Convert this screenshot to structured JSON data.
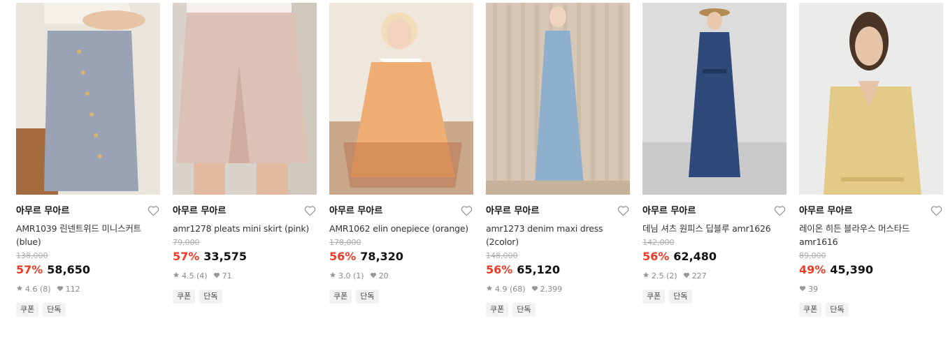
{
  "products": [
    {
      "brand": "아무르 무아르",
      "name": "AMR1039 린넨트위드 미니스커트 (blue)",
      "original_price": "138,000",
      "discount": "57%",
      "price": "58,650",
      "rating": "4.6",
      "review_count": "(8)",
      "likes": "112",
      "tags": [
        "쿠폰",
        "단독"
      ],
      "palette": {
        "bg": "#e9e4dc",
        "accent": "#9aa3b5",
        "skin": "#e8c4a6"
      }
    },
    {
      "brand": "아무르 무아르",
      "name": "amr1278 pleats mini skirt (pink)",
      "original_price": "79,000",
      "discount": "57%",
      "price": "33,575",
      "rating": "4.5",
      "review_count": "(4)",
      "likes": "71",
      "tags": [
        "쿠폰",
        "단독"
      ],
      "palette": {
        "bg": "#d9d3cb",
        "accent": "#dcc1b6",
        "skin": "#e3b99f"
      }
    },
    {
      "brand": "아무르 무아르",
      "name": "AMR1062 elin onepiece (orange)",
      "original_price": "178,000",
      "discount": "56%",
      "price": "78,320",
      "rating": "3.0",
      "review_count": "(1)",
      "likes": "20",
      "tags": [
        "쿠폰",
        "단독"
      ],
      "palette": {
        "bg": "#efe6dc",
        "accent": "#f0ad73",
        "skin": "#f1d3bd"
      }
    },
    {
      "brand": "아무르 무아르",
      "name": "amr1273 denim maxi dress (2color)",
      "original_price": "148,000",
      "discount": "56%",
      "price": "65,120",
      "rating": "4.9",
      "review_count": "(68)",
      "likes": "2,399",
      "tags": [
        "쿠폰",
        "단독"
      ],
      "palette": {
        "bg": "#d8c7b6",
        "accent": "#8eb0cc",
        "skin": "#efd3bf"
      }
    },
    {
      "brand": "아무르 무아르",
      "name": "데님 셔츠 원피스 딥블루 amr1626",
      "original_price": "142,000",
      "discount": "56%",
      "price": "62,480",
      "rating": "2.5",
      "review_count": "(2)",
      "likes": "227",
      "tags": [
        "쿠폰",
        "단독"
      ],
      "palette": {
        "bg": "#dcdcdc",
        "accent": "#2f4a7a",
        "skin": "#e9c8ad"
      }
    },
    {
      "brand": "아무르 무아르",
      "name": "레이온 히든 블라우스 머스타드 amr1616",
      "original_price": "89,000",
      "discount": "49%",
      "price": "45,390",
      "rating": "",
      "review_count": "",
      "likes": "39",
      "tags": [
        "쿠폰",
        "단독"
      ],
      "palette": {
        "bg": "#ebebea",
        "accent": "#e3ca86",
        "skin": "#e6c4a8"
      }
    }
  ],
  "colors": {
    "discount": "#ee3b26",
    "tag_bg": "#f2f2f2"
  },
  "icons": {
    "like": "heart-outline-icon",
    "rating": "star-icon",
    "likes_count": "heart-filled-icon"
  }
}
